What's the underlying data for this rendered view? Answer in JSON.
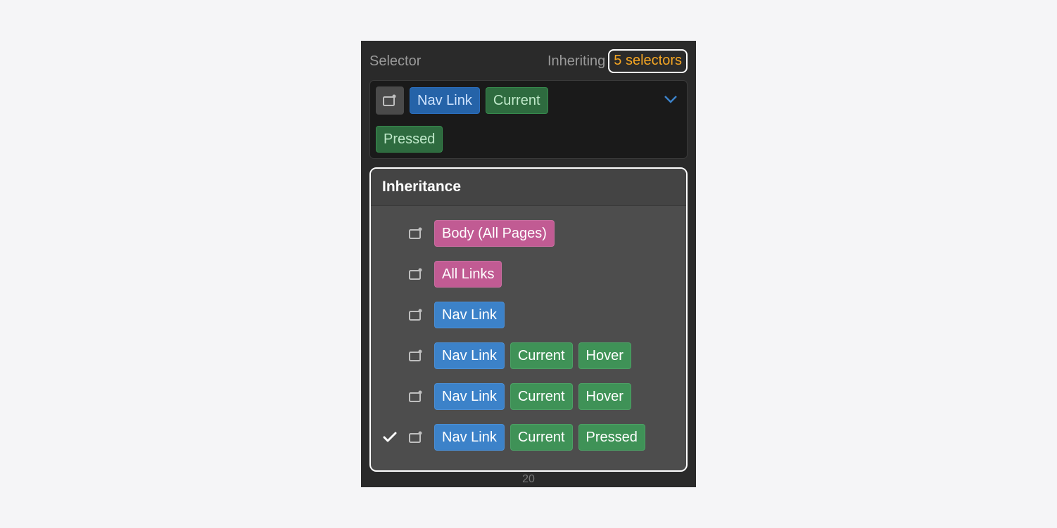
{
  "header": {
    "label": "Selector",
    "inheriting_label": "Inheriting",
    "selectors_count": "5 selectors"
  },
  "selector_field": {
    "class_tag": "Nav Link",
    "state_tag_1": "Current",
    "state_tag_2": "Pressed"
  },
  "popover": {
    "title": "Inheritance",
    "rows": [
      {
        "checked": false,
        "tags": [
          {
            "label": "Body (All Pages)",
            "kind": "pink"
          }
        ]
      },
      {
        "checked": false,
        "tags": [
          {
            "label": "All Links",
            "kind": "pink"
          }
        ]
      },
      {
        "checked": false,
        "tags": [
          {
            "label": "Nav Link",
            "kind": "blue"
          }
        ]
      },
      {
        "checked": false,
        "tags": [
          {
            "label": "Nav Link",
            "kind": "blue"
          },
          {
            "label": "Current",
            "kind": "green"
          },
          {
            "label": "Hover",
            "kind": "green"
          }
        ]
      },
      {
        "checked": false,
        "tags": [
          {
            "label": "Nav Link",
            "kind": "blue"
          },
          {
            "label": "Current",
            "kind": "green"
          },
          {
            "label": "Hover",
            "kind": "green"
          }
        ]
      },
      {
        "checked": true,
        "tags": [
          {
            "label": "Nav Link",
            "kind": "blue"
          },
          {
            "label": "Current",
            "kind": "green"
          },
          {
            "label": "Pressed",
            "kind": "green"
          }
        ]
      }
    ]
  },
  "footer_number": "20"
}
